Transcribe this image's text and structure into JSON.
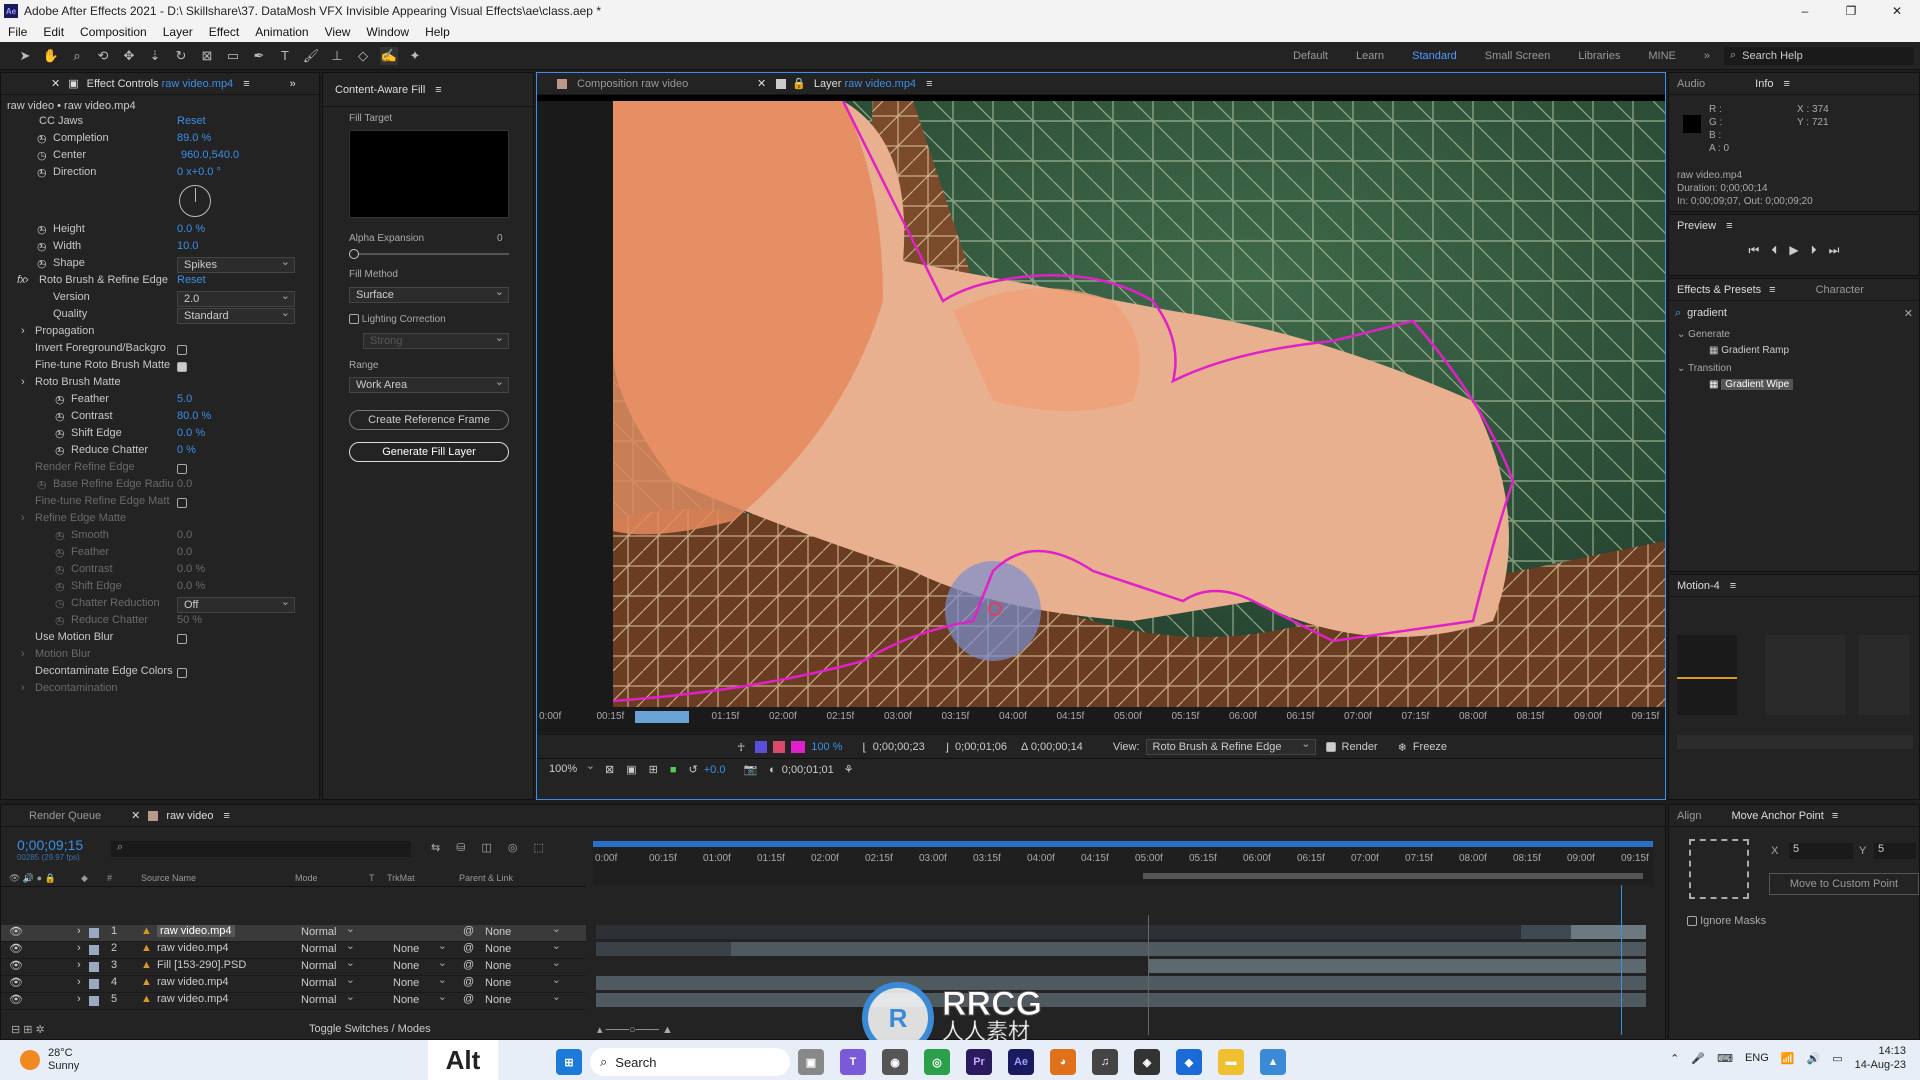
{
  "window": {
    "title": "Adobe After Effects 2021 - D:\\ Skillshare\\37. DataMosh VFX Invisible Appearing Visual Effects\\ae\\class.aep *",
    "min": "–",
    "max": "❐",
    "close": "✕"
  },
  "menu": [
    "File",
    "Edit",
    "Composition",
    "Layer",
    "Effect",
    "Animation",
    "View",
    "Window",
    "Help"
  ],
  "workspaces": [
    "Default",
    "Learn",
    "Standard",
    "Small Screen",
    "Libraries",
    "MINE"
  ],
  "search_help": "Search Help",
  "effect_controls": {
    "tab": "Effect Controls",
    "tab_file": "raw video.mp4",
    "subtitle": "raw video • raw video.mp4",
    "rows": [
      {
        "label": "CC Jaws",
        "value": "Reset"
      },
      {
        "label": "Completion",
        "value": "89.0 %"
      },
      {
        "label": "Center",
        "value": "960.0,540.0"
      },
      {
        "label": "Direction",
        "value": "0 x+0.0 °"
      },
      {
        "label": "Height",
        "value": "0.0 %"
      },
      {
        "label": "Width",
        "value": "10.0"
      },
      {
        "label": "Shape",
        "value": "Spikes"
      },
      {
        "label": "Roto Brush & Refine Edge",
        "value": "Reset"
      },
      {
        "label": "Version",
        "value": "2.0"
      },
      {
        "label": "Quality",
        "value": "Standard"
      },
      {
        "label": "Propagation",
        "value": ""
      },
      {
        "label": "Invert Foreground/Backgro",
        "value": ""
      },
      {
        "label": "Fine-tune Roto Brush Matte",
        "value": ""
      },
      {
        "label": "Roto Brush Matte",
        "value": ""
      },
      {
        "label": "Feather",
        "value": "5.0"
      },
      {
        "label": "Contrast",
        "value": "80.0 %"
      },
      {
        "label": "Shift Edge",
        "value": "0.0 %"
      },
      {
        "label": "Reduce Chatter",
        "value": "0 %"
      },
      {
        "label": "Render Refine Edge",
        "value": ""
      },
      {
        "label": "Base Refine Edge Radiu",
        "value": "0.0"
      },
      {
        "label": "Fine-tune Refine Edge Matt",
        "value": ""
      },
      {
        "label": "Refine Edge Matte",
        "value": ""
      },
      {
        "label": "Smooth",
        "value": "0.0"
      },
      {
        "label": "Feather",
        "value": "0.0"
      },
      {
        "label": "Contrast",
        "value": "0.0 %"
      },
      {
        "label": "Shift Edge",
        "value": "0.0 %"
      },
      {
        "label": "Chatter Reduction",
        "value": "Off"
      },
      {
        "label": "Reduce Chatter",
        "value": "50 %"
      },
      {
        "label": "Use Motion Blur",
        "value": ""
      },
      {
        "label": "Motion Blur",
        "value": ""
      },
      {
        "label": "Decontaminate Edge Colors",
        "value": ""
      },
      {
        "label": "Decontamination",
        "value": ""
      }
    ]
  },
  "caf": {
    "title": "Content-Aware Fill",
    "fill_target": "Fill Target",
    "alpha_expansion": "Alpha Expansion",
    "alpha_value": "0",
    "fill_method": "Fill Method",
    "fill_method_value": "Surface",
    "lighting": "Lighting Correction",
    "strength": "Strong",
    "range": "Range",
    "range_value": "Work Area",
    "create_ref": "Create Reference Frame",
    "generate": "Generate Fill Layer"
  },
  "viewer": {
    "comp_tab": "Composition raw video",
    "layer_tab": "Layer",
    "layer_file": "raw video.mp4",
    "ruler": [
      "0:00f",
      "00:15f",
      "01:00f",
      "01:15f",
      "02:00f",
      "02:15f",
      "03:00f",
      "03:15f",
      "04:00f",
      "04:15f",
      "05:00f",
      "05:15f",
      "06:00f",
      "06:15f",
      "07:00f",
      "07:15f",
      "08:00f",
      "08:15f",
      "09:00f",
      "09:15f"
    ],
    "pct": "100 %",
    "in": "0;00;00;23",
    "out": "0;00;01;06",
    "delta": "Δ 0;00;00;14",
    "view_label": "View:",
    "view_value": "Roto Brush & Refine Edge",
    "render": "Render",
    "freeze": "Freeze",
    "zoom": "100%",
    "exposure": "+0.0",
    "time": "0;00;01;01"
  },
  "info": {
    "audio": "Audio",
    "tab": "Info",
    "r": "R :",
    "g": "G :",
    "b": "B :",
    "a": "A : 0",
    "x": "X : 374",
    "y": "Y : 721",
    "file": "raw video.mp4",
    "duration": "Duration: 0;00;00;14",
    "inout": "In: 0;00;09;07, Out: 0;00;09;20"
  },
  "preview": {
    "title": "Preview"
  },
  "effects": {
    "tab": "Effects & Presets",
    "tab2": "Character",
    "search": "gradient",
    "generate": "Generate",
    "gradient_ramp": "Gradient Ramp",
    "transition": "Transition",
    "gradient_wipe": "Gradient Wipe"
  },
  "motion": {
    "title": "Motion-4"
  },
  "align": {
    "tab": "Align",
    "tab2": "Move Anchor Point",
    "x_label": "X",
    "x_value": "5",
    "y_label": "Y",
    "y_value": "5",
    "move_btn": "Move to Custom Point",
    "ignore": "Ignore Masks"
  },
  "timeline": {
    "render_queue": "Render Queue",
    "comp_tab": "raw video",
    "timecode": "0;00;09;15",
    "fps": "00285 (29.97 fps)",
    "cols": [
      "#",
      "Source Name",
      "Mode",
      "T",
      "TrkMat",
      "Parent & Link"
    ],
    "ruler": [
      "0:00f",
      "00:15f",
      "01:00f",
      "01:15f",
      "02:00f",
      "02:15f",
      "03:00f",
      "03:15f",
      "04:00f",
      "04:15f",
      "05:00f",
      "05:15f",
      "06:00f",
      "06:15f",
      "07:00f",
      "07:15f",
      "08:00f",
      "08:15f",
      "09:00f",
      "09:15f"
    ],
    "layers": [
      {
        "num": "1",
        "name": "raw video.mp4",
        "mode": "Normal",
        "trk": "",
        "parent": "None"
      },
      {
        "num": "2",
        "name": "raw video.mp4",
        "mode": "Normal",
        "trk": "None",
        "parent": "None"
      },
      {
        "num": "3",
        "name": "Fill [153-290].PSD",
        "mode": "Normal",
        "trk": "None",
        "parent": "None"
      },
      {
        "num": "4",
        "name": "raw video.mp4",
        "mode": "Normal",
        "trk": "None",
        "parent": "None"
      },
      {
        "num": "5",
        "name": "raw video.mp4",
        "mode": "Normal",
        "trk": "None",
        "parent": "None"
      }
    ],
    "toggle": "Toggle Switches / Modes"
  },
  "taskbar": {
    "temp": "28°C",
    "weather": "Sunny",
    "alt": "Alt",
    "search": "Search",
    "lang": "ENG",
    "time": "14:13",
    "date": "14-Aug-23"
  },
  "watermark": {
    "brand": "RRCG",
    "sub": "人人素材"
  },
  "colors": {
    "accent": "#3b8fe8",
    "bg": "#232323",
    "edge": "#e020c8"
  }
}
